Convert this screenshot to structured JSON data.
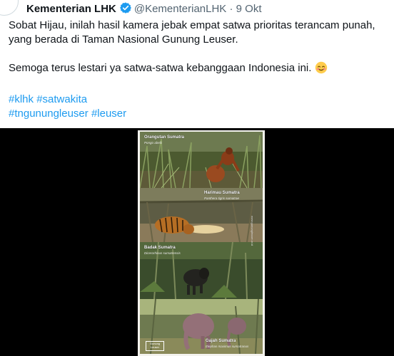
{
  "tweet": {
    "author_name": "Kementerian LHK",
    "handle": "@KementerianLHK",
    "separator": "·",
    "date": "9 Okt",
    "line1": "Sobat Hijau, inilah hasil kamera jebak empat satwa prioritas terancam punah,",
    "line2": "yang berada di Taman Nasional Gunung Leuser.",
    "line3": "Semoga terus lestari ya satwa-satwa kebanggaan Indonesia ini.",
    "hashtags_line1": [
      "#klhk",
      "#satwakita"
    ],
    "hashtags_line2": [
      "#tngunungleuser",
      "#leuser"
    ]
  },
  "media": {
    "panels": [
      {
        "title": "Orangutan Sumatra",
        "latin": "Pongo abelii"
      },
      {
        "title": "Harimau Sumatra",
        "latin": "Panthera tigris sumatrae"
      },
      {
        "title": "Badak Sumatra",
        "latin": "Dicerorhinus sumatrensis"
      },
      {
        "title": "Gajah Sumatra",
        "latin": "Elephas maximus sumatranus"
      }
    ],
    "logo_text": "Gunung Leuser",
    "watermark_text": "www.gunungleuser.or.id"
  },
  "colors": {
    "text": "#0f1419",
    "muted": "#536471",
    "link": "#1d9bf0",
    "verified": "#1d9bf0",
    "media_bg": "#000000"
  },
  "icons": {
    "verified": "verified-badge-icon",
    "emoji": "smiling-face-with-smiling-eyes-emoji"
  }
}
